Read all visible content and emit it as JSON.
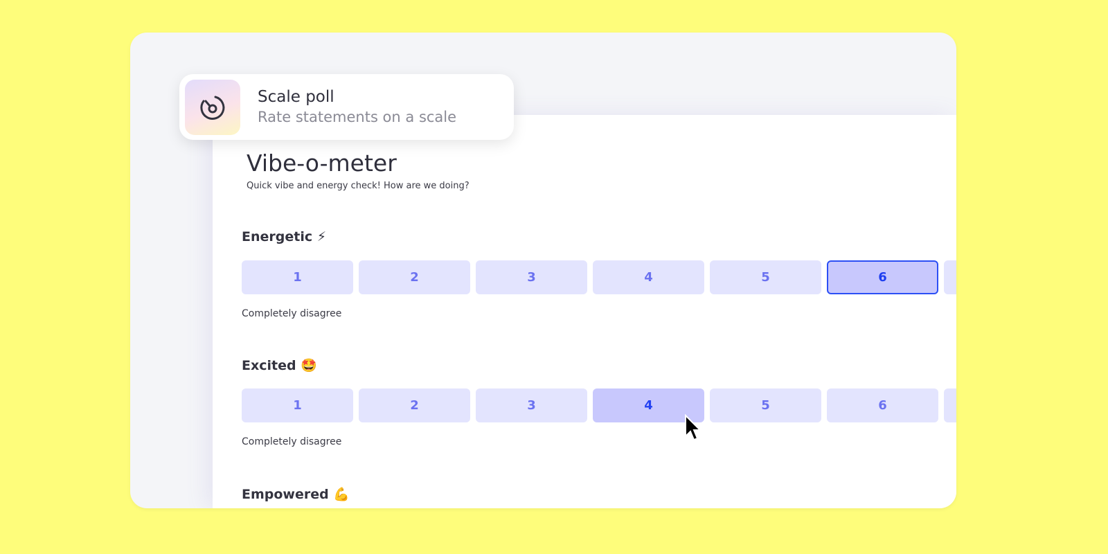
{
  "popup": {
    "title": "Scale poll",
    "subtitle": "Rate statements on a scale",
    "icon": "gauge-icon"
  },
  "poll": {
    "title": "Vibe-o-meter",
    "description": "Quick vibe and energy check! How are we doing?"
  },
  "questions": [
    {
      "label": "Energetic ⚡",
      "options": [
        "1",
        "2",
        "3",
        "4",
        "5",
        "6",
        ""
      ],
      "selected": "6",
      "min_label": "Completely disagree"
    },
    {
      "label": "Excited 🤩",
      "options": [
        "1",
        "2",
        "3",
        "4",
        "5",
        "6",
        ""
      ],
      "hovered": "4",
      "min_label": "Completely disagree"
    },
    {
      "label": "Empowered 💪"
    }
  ],
  "colors": {
    "background": "#fefd7b",
    "option": "#e3e4fe",
    "selected": "#c8c8fd",
    "accent": "#2c4ff5"
  }
}
